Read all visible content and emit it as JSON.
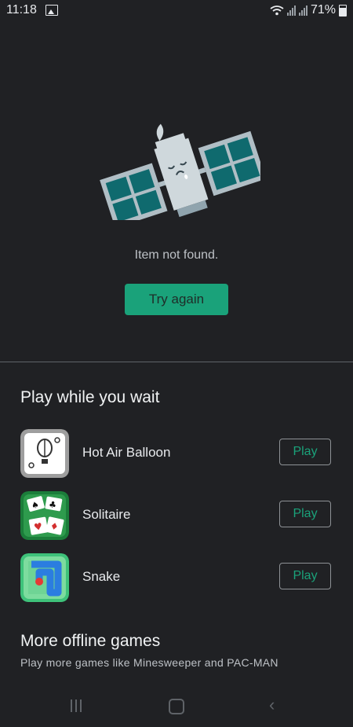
{
  "status_bar": {
    "time": "11:18",
    "battery": "71%"
  },
  "error": {
    "message": "Item not found.",
    "retry_label": "Try again"
  },
  "games_section": {
    "title": "Play while you wait",
    "games": [
      {
        "name": "Hot Air Balloon",
        "action": "Play",
        "icon": "hot-air-balloon-icon"
      },
      {
        "name": "Solitaire",
        "action": "Play",
        "icon": "solitaire-icon"
      },
      {
        "name": "Snake",
        "action": "Play",
        "icon": "snake-icon"
      }
    ]
  },
  "more_offline": {
    "title": "More offline games",
    "description": "Play more games like Minesweeper and PAC-MAN"
  },
  "colors": {
    "background": "#202124",
    "accent": "#1aa27a"
  }
}
